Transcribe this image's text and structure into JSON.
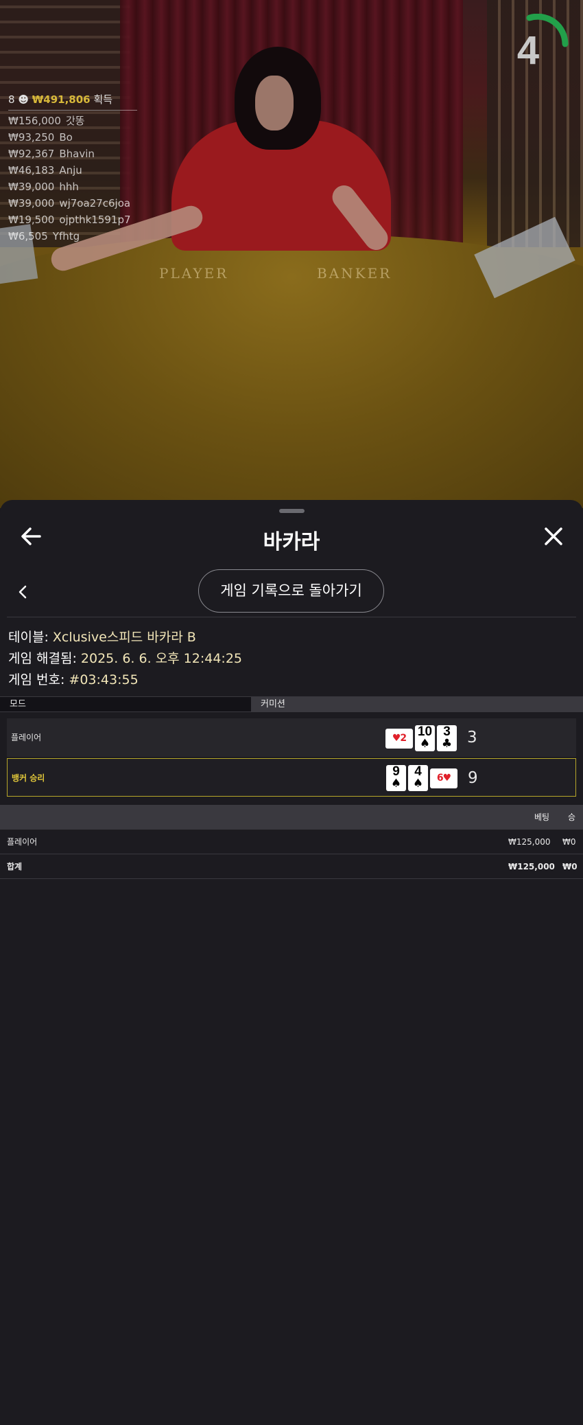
{
  "video": {
    "felt_player": "PLAYER",
    "felt_banker": "BANKER",
    "countdown": "4",
    "winners": {
      "count": "8",
      "total": "₩491,806",
      "suffix": "획득",
      "rows": [
        {
          "amount": "₩156,000",
          "name": "갓똥"
        },
        {
          "amount": "₩93,250",
          "name": "Bo"
        },
        {
          "amount": "₩92,367",
          "name": "Bhavin"
        },
        {
          "amount": "₩46,183",
          "name": "Anju"
        },
        {
          "amount": "₩39,000",
          "name": "hhh"
        },
        {
          "amount": "₩39,000",
          "name": "wj7oa27c6joa"
        },
        {
          "amount": "₩19,500",
          "name": "ojpthk1591p7"
        },
        {
          "amount": "₩6,505",
          "name": "Yfhtg"
        }
      ]
    }
  },
  "sheet": {
    "title": "바카라",
    "history_button": "게임 기록으로 돌아가기",
    "table_label": "테이블:",
    "table_value": "Xclusive스피드 바카라 B",
    "settled_label": "게임 해결됨:",
    "settled_value": "2025. 6. 6. 오후 12:44:25",
    "game_no_label": "게임 번호:",
    "game_no_value": "#03:43:55",
    "mode_label": "모드",
    "commission_label": "커미션",
    "results": [
      {
        "label": "플레이어",
        "score": "3",
        "cards": [
          {
            "rank": "2",
            "suit": "♥",
            "color": "#e0202a",
            "sideways": true
          },
          {
            "rank": "10",
            "suit": "♠",
            "color": "#000000",
            "sideways": false
          },
          {
            "rank": "3",
            "suit": "♣",
            "color": "#000000",
            "sideways": false
          }
        ]
      },
      {
        "label": "뱅커 승리",
        "score": "9",
        "cards": [
          {
            "rank": "9",
            "suit": "♠",
            "color": "#000000",
            "sideways": false
          },
          {
            "rank": "4",
            "suit": "♠",
            "color": "#000000",
            "sideways": false
          },
          {
            "rank": "6",
            "suit": "♥",
            "color": "#e0202a",
            "sideways": true
          }
        ]
      }
    ],
    "bets": {
      "header_bet": "베팅",
      "header_win": "승",
      "rows": [
        {
          "label": "플레이어",
          "bet": "₩125,000",
          "win": "₩0"
        },
        {
          "label": "합계",
          "bet": "₩125,000",
          "win": "₩0"
        }
      ]
    }
  },
  "colors": {
    "accent_gold": "#d8b93a",
    "win_border": "#b7a72a",
    "timer_green": "#22a04a",
    "info_value": "#f2e6b8"
  }
}
